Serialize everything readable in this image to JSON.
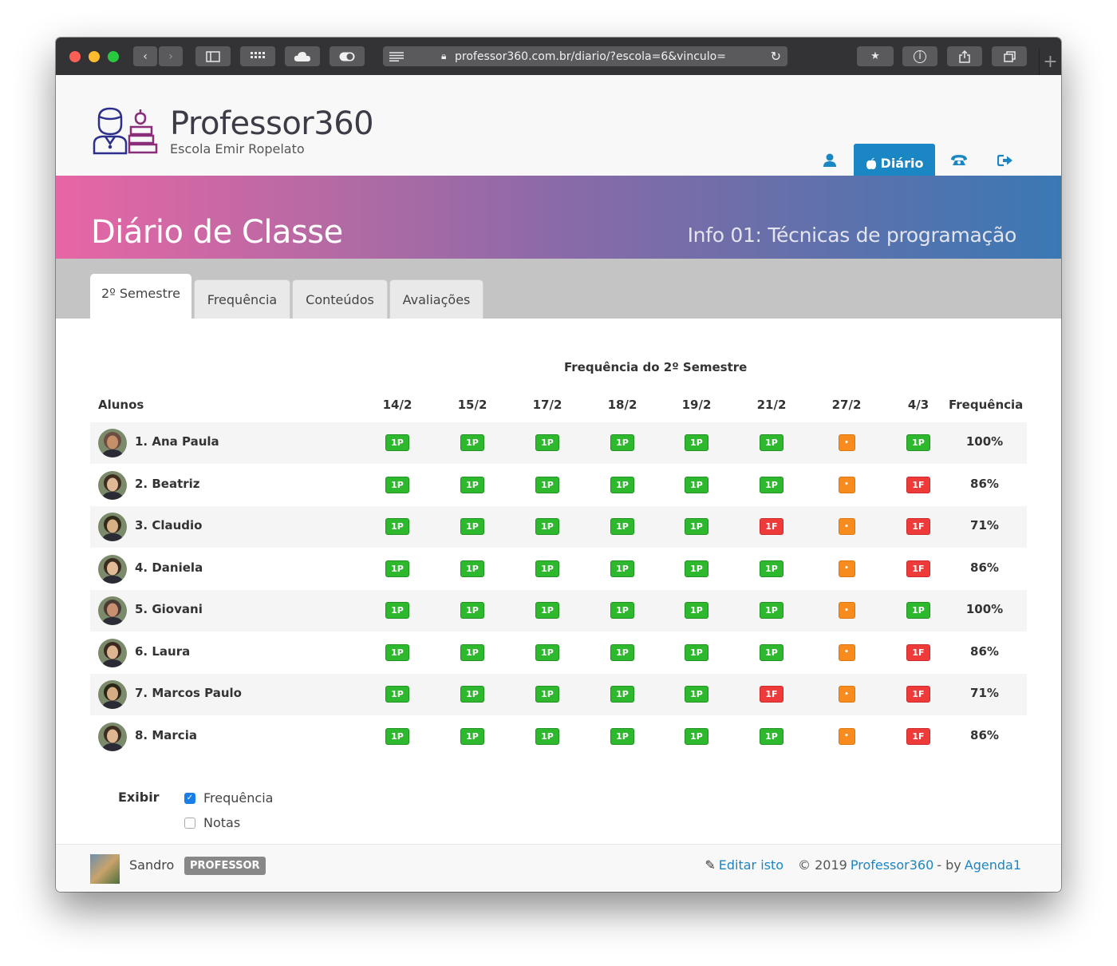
{
  "browser": {
    "url": "professor360.com.br/diario/?escola=6&vinculo="
  },
  "header": {
    "brand": "Professor360",
    "school": "Escola Emir Ropelato",
    "diario_label": "Diário"
  },
  "banner": {
    "title": "Diário de Classe",
    "subtitle": "Info 01: Técnicas de programação"
  },
  "tabs": [
    {
      "label": "2º Semestre"
    },
    {
      "label": "Frequência"
    },
    {
      "label": "Conteúdos"
    },
    {
      "label": "Avaliações"
    }
  ],
  "table": {
    "caption": "Frequência do 2º Semestre",
    "col_students": "Alunos",
    "dates": [
      "14/2",
      "15/2",
      "17/2",
      "18/2",
      "19/2",
      "21/2",
      "27/2",
      "4/3"
    ],
    "col_freq": "Frequência",
    "students": [
      {
        "name": "1. Ana Paula",
        "marks": [
          "1P",
          "1P",
          "1P",
          "1P",
          "1P",
          "1P",
          "•",
          "1P"
        ],
        "freq": "100%"
      },
      {
        "name": "2. Beatriz",
        "marks": [
          "1P",
          "1P",
          "1P",
          "1P",
          "1P",
          "1P",
          "•",
          "1F"
        ],
        "freq": "86%"
      },
      {
        "name": "3. Claudio",
        "marks": [
          "1P",
          "1P",
          "1P",
          "1P",
          "1P",
          "1F",
          "•",
          "1F"
        ],
        "freq": "71%"
      },
      {
        "name": "4. Daniela",
        "marks": [
          "1P",
          "1P",
          "1P",
          "1P",
          "1P",
          "1P",
          "•",
          "1F"
        ],
        "freq": "86%"
      },
      {
        "name": "5. Giovani",
        "marks": [
          "1P",
          "1P",
          "1P",
          "1P",
          "1P",
          "1P",
          "•",
          "1P"
        ],
        "freq": "100%"
      },
      {
        "name": "6. Laura",
        "marks": [
          "1P",
          "1P",
          "1P",
          "1P",
          "1P",
          "1P",
          "•",
          "1F"
        ],
        "freq": "86%"
      },
      {
        "name": "7. Marcos Paulo",
        "marks": [
          "1P",
          "1P",
          "1P",
          "1P",
          "1P",
          "1F",
          "•",
          "1F"
        ],
        "freq": "71%"
      },
      {
        "name": "8. Marcia",
        "marks": [
          "1P",
          "1P",
          "1P",
          "1P",
          "1P",
          "1P",
          "•",
          "1F"
        ],
        "freq": "86%"
      }
    ]
  },
  "display": {
    "label": "Exibir",
    "options": [
      {
        "label": "Frequência",
        "checked": true
      },
      {
        "label": "Notas",
        "checked": false
      }
    ]
  },
  "footer": {
    "user": "Sandro",
    "role": "PROFESSOR",
    "edit": "Editar isto",
    "copyright": "© 2019",
    "product": "Professor360",
    "by": "- by",
    "company": "Agenda1"
  },
  "colors": {
    "accent": "#1a86c4",
    "present": "#2eb82e",
    "absent": "#ef3a3a",
    "pending": "#f88b1e"
  }
}
